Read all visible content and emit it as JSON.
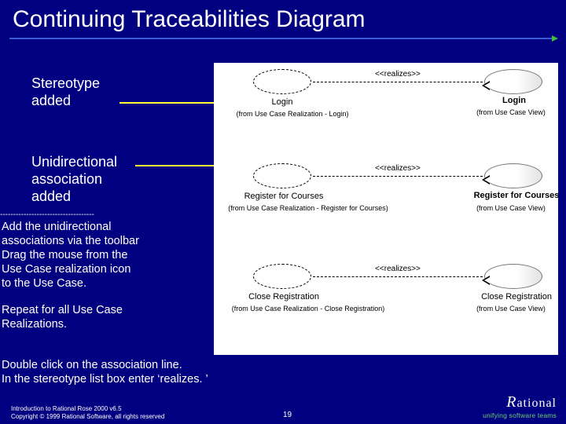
{
  "title": "Continuing Traceabilities Diagram",
  "captions": {
    "stereotype": "Stereotype\nadded",
    "unidir": "Unidirectional\nassociation\nadded",
    "dashes": "------------------------------------",
    "instr1": "Add the unidirectional\n associations via the toolbar\nDrag the mouse from the\n Use Case realization icon\n to the Use Case.",
    "instr2": "Repeat for all Use Case\nRealizations.",
    "instr3": "Double click on the association line.\nIn the stereotype list box enter ‘realizes. ’"
  },
  "diagram": {
    "rows": [
      {
        "realizes": "<<realizes>>",
        "left_label": "Login",
        "left_from": "(from Use Case Realization - Login)",
        "right_label": "Login",
        "right_from": "(from Use Case View)"
      },
      {
        "realizes": "<<realizes>>",
        "left_label": "Register for Courses",
        "left_from": "(from Use Case Realization - Register for Courses)",
        "right_label": "Register for Courses",
        "right_from": "(from Use Case View)"
      },
      {
        "realizes": "<<realizes>>",
        "left_label": "Close Registration",
        "left_from": "(from Use Case Realization - Close Registration)",
        "right_label": "Close Registration",
        "right_from": "(from Use Case View)"
      }
    ]
  },
  "footer": {
    "line1": "Introduction to Rational Rose 2000 v6.5",
    "line2": "Copyright © 1999 Rational Software, all rights reserved",
    "page": "19",
    "brand": "Rational",
    "tagline": "unifying software teams"
  }
}
